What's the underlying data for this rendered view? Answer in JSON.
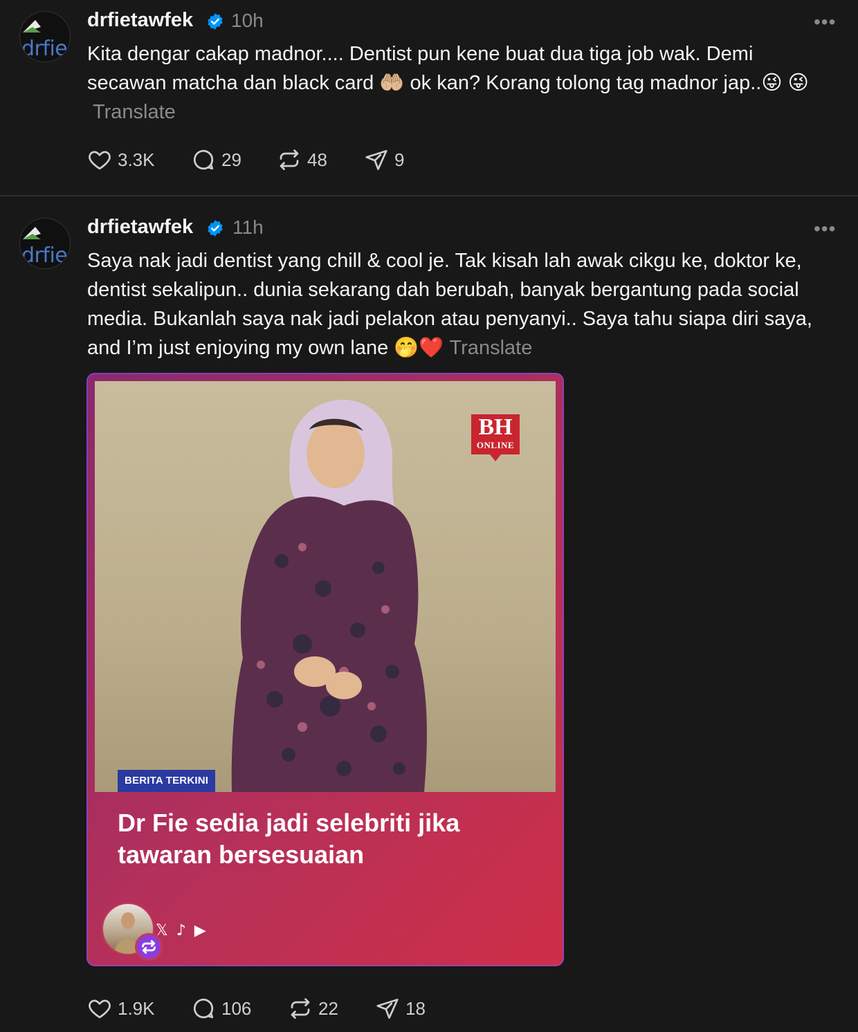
{
  "posts": [
    {
      "username": "drfietawfek",
      "avatar_text": "drfie",
      "verified": true,
      "time": "10h",
      "more": "•••",
      "text": "Kita dengar cakap madnor.... Dentist pun kene buat dua tiga job wak. Demi secawan matcha dan black card 🤲🏼 ok kan? Korang tolong tag madnor jap..😜 😜",
      "translate": "Translate",
      "likes": "3.3K",
      "replies": "29",
      "reposts": "48",
      "shares": "9"
    },
    {
      "username": "drfietawfek",
      "avatar_text": "drfie",
      "verified": true,
      "time": "11h",
      "more": "•••",
      "text": "Saya nak jadi dentist yang chill & cool je. Tak kisah lah awak cikgu ke, doktor ke, dentist sekalipun.. dunia sekarang dah berubah, banyak bergantung pada social media. Bukanlah saya nak jadi pelakon atau penyanyi.. Saya tahu siapa diri saya, and I’m just enjoying my own lane 🤭❤️",
      "translate": "Translate",
      "card": {
        "logo_main": "BH",
        "logo_sub": "ONLINE",
        "badge": "BERITA TERKINI",
        "headline": "Dr Fie sedia jadi selebriti jika tawaran bersesuaian",
        "socials": [
          "𝕏",
          "♪",
          "▶"
        ]
      },
      "likes": "1.9K",
      "replies": "106",
      "reposts": "22",
      "shares": "18"
    }
  ],
  "colors": {
    "background": "#181818",
    "text": "#f3f5f7",
    "muted": "#8a8a8a",
    "verified": "#0095f6",
    "card_gradient_start": "#8a2a6c",
    "card_gradient_end": "#cf2f47",
    "badge": "#2a3aa0",
    "bh_red": "#c9252f"
  },
  "icons": [
    "heart-icon",
    "reply-icon",
    "repost-icon",
    "share-icon",
    "verified-icon",
    "more-icon"
  ]
}
